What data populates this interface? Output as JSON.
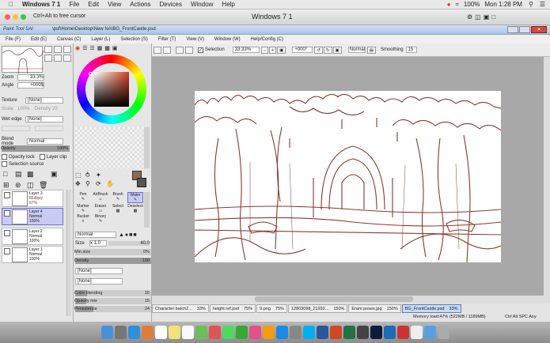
{
  "mac_menu": {
    "app": "Windows 7 1",
    "items": [
      "File",
      "Edit",
      "View",
      "Actions",
      "Devices",
      "Window",
      "Help"
    ],
    "wifi_pct": "100%",
    "time": "Mon 1:28 PM"
  },
  "vm": {
    "hint": "Ctrl+Alt to free cursor",
    "title": "Windows 7 1"
  },
  "sai": {
    "logo": "Paint Tool SAI",
    "path": "\\psf\\Home\\Desktop\\New NA\\BG_FrontCastle.psd",
    "menu": [
      "File (F)",
      "Edit (E)",
      "Canvas (C)",
      "Layer (L)",
      "Selection (S)",
      "Filter (T)",
      "View (V)",
      "Window (W)",
      "Help/Config (C)"
    ]
  },
  "nav": {
    "zoom_label": "Zoom",
    "zoom_value": "33.3%",
    "angle_label": "Angle",
    "angle_value": "+000$"
  },
  "layer_panel": {
    "texture_label": "Texture",
    "texture_value": "[None]",
    "scale_label": "Scale",
    "scale_value": "100%",
    "density_label": "Density",
    "density_value": "20",
    "wetedge_label": "Wet edge",
    "wetedge_value": "[None]",
    "blend_label": "Blend mode",
    "blend_value": "Normal",
    "opacity_label": "Opacity",
    "opacity_value": "100%",
    "opacity_lock": "Opacity lock",
    "layer_clip": "Layer clip",
    "selection_source": "Selection source",
    "layers": [
      {
        "name": "Layer 3",
        "mode": "Multiply",
        "opacity": "67%",
        "selected": false
      },
      {
        "name": "Layer 4",
        "mode": "Normal",
        "opacity": "100%",
        "selected": true
      },
      {
        "name": "Layer 2",
        "mode": "Normal",
        "opacity": "100%",
        "selected": false
      },
      {
        "name": "Layer 1",
        "mode": "Normal",
        "opacity": "100%",
        "selected": false
      }
    ]
  },
  "tools": {
    "brushes": [
      "Pen",
      "AirBrush",
      "Brush",
      "Water",
      "Marker",
      "Eraser",
      "Select",
      "Deselect",
      "Bucket",
      "Binary"
    ],
    "brush_mode": "Normal",
    "size_label": "Size",
    "size_mult": "x 1.0",
    "size_value": "40.0",
    "minsize_label": "Min size",
    "minsize_value": "0%",
    "density_label": "Density",
    "density_value": "100",
    "shape1": "[None]",
    "shape2": "[None]",
    "color_blending_label": "Color blending",
    "color_blending_value": "16",
    "opacity_mix_label": "Opacity mix",
    "opacity_mix_value": "15",
    "persistence_label": "Persistence",
    "persistence_value": "24"
  },
  "toolbar": {
    "selection_label": "Selection",
    "zoom": "33.33%",
    "rotation": "+000°",
    "mode": "Normal",
    "smoothing_label": "Smoothing",
    "smoothing_value": "15"
  },
  "tabs": [
    {
      "name": "Character batch2...",
      "zoom": "33%",
      "active": false
    },
    {
      "name": "height ref.psd",
      "zoom": "75%",
      "active": false
    },
    {
      "name": "9.png",
      "zoom": "75%",
      "active": false
    },
    {
      "name": "12803098_21932...",
      "zoom": "150%",
      "active": false
    },
    {
      "name": "Eram poses.jpg",
      "zoom": "150%",
      "active": false
    },
    {
      "name": "BG_FrontCastle.psd",
      "zoom": "33%",
      "active": true
    }
  ],
  "status": {
    "memory": "Memory load:47% (522MB / 1189MB)",
    "keys": "Ctrl Alt SPC Any"
  },
  "colors": {
    "accent": "#6b6fd1",
    "sketch": "#8b3a2e",
    "canvas_bg": "#a8a8a8"
  }
}
